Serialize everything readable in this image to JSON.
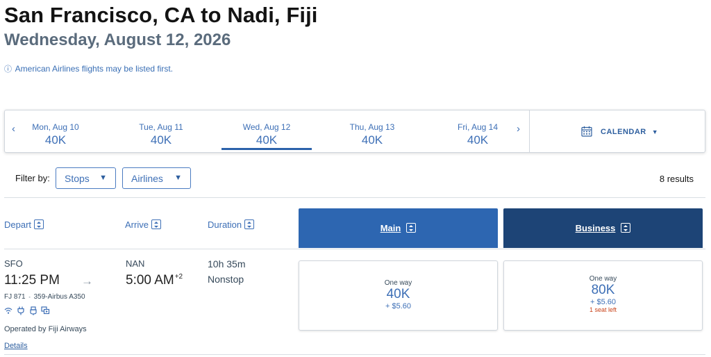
{
  "route": {
    "title": "San Francisco, CA to Nadi, Fiji",
    "date": "Wednesday, August 12, 2026",
    "notice": "American Airlines flights may be listed first.",
    "notice_icon": "info-icon"
  },
  "date_bar": {
    "prev_icon": "‹",
    "next_icon": "›",
    "dates": [
      {
        "label": "Mon, Aug 10",
        "price": "40K"
      },
      {
        "label": "Tue, Aug 11",
        "price": "40K"
      },
      {
        "label": "Wed, Aug 12",
        "price": "40K",
        "selected": true
      },
      {
        "label": "Thu, Aug 13",
        "price": "40K"
      },
      {
        "label": "Fri, Aug 14",
        "price": "40K"
      }
    ],
    "calendar_label": "CALENDAR"
  },
  "filters": {
    "label": "Filter by:",
    "stops": "Stops",
    "airlines": "Airlines",
    "results": "8 results"
  },
  "columns": {
    "depart": "Depart",
    "arrive": "Arrive",
    "duration": "Duration",
    "main": "Main",
    "business": "Business"
  },
  "flight": {
    "origin": "SFO",
    "depart_time": "11:25 PM",
    "destination": "NAN",
    "arrive_time": "5:00 AM",
    "day_offset": "+2",
    "duration": "10h 35m",
    "stops": "Nonstop",
    "flight_number": "FJ 871",
    "aircraft": "359-Airbus A350",
    "separator": "▪",
    "amenities": [
      "wifi-icon",
      "power-icon",
      "usb-icon",
      "entertainment-icon"
    ],
    "operated_by": "Operated by Fiji Airways",
    "details": "Details"
  },
  "fares": {
    "main": {
      "type": "One way",
      "points": "40K",
      "taxes": "+ $5.60"
    },
    "business": {
      "type": "One way",
      "points": "80K",
      "taxes": "+ $5.60",
      "availability": "1 seat left"
    }
  },
  "colors": {
    "accent": "#3d6fb6",
    "main_header": "#2d66b1",
    "business_header": "#1d4476",
    "warning": "#c9431a"
  }
}
